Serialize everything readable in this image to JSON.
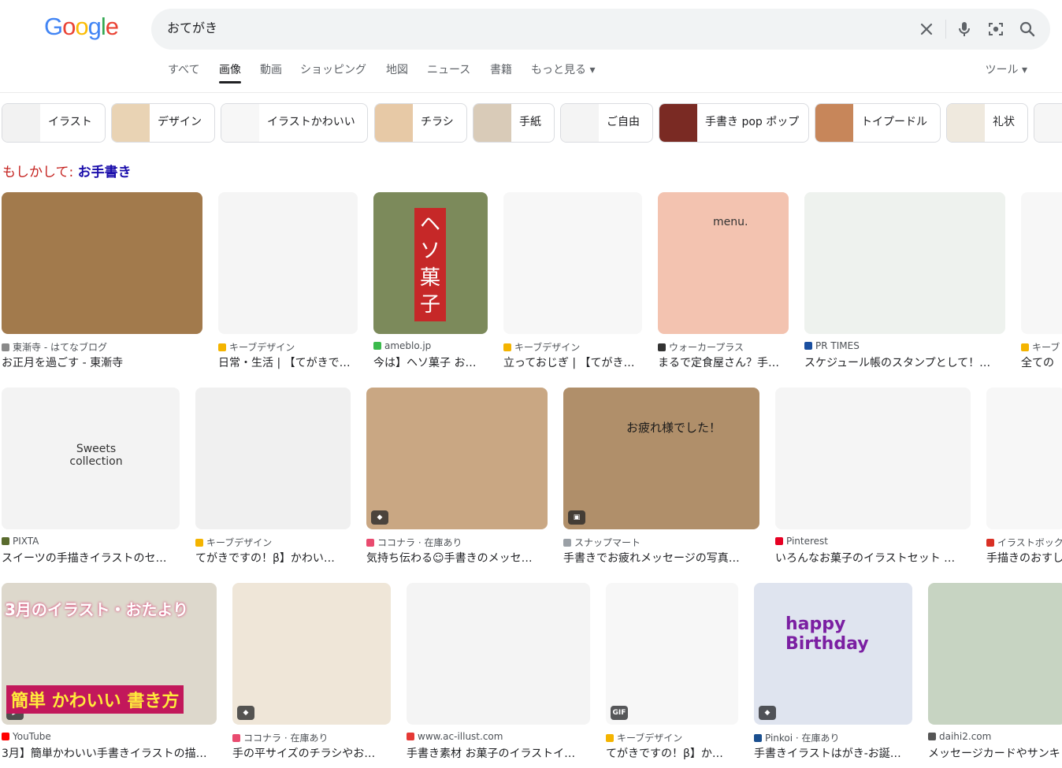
{
  "logo": {
    "letters": [
      {
        "ch": "G",
        "color": "#4285F4"
      },
      {
        "ch": "o",
        "color": "#EA4335"
      },
      {
        "ch": "o",
        "color": "#FBBC05"
      },
      {
        "ch": "g",
        "color": "#4285F4"
      },
      {
        "ch": "l",
        "color": "#34A853"
      },
      {
        "ch": "e",
        "color": "#EA4335"
      }
    ]
  },
  "search": {
    "query": "おてがき"
  },
  "tabs": [
    "すべて",
    "画像",
    "動画",
    "ショッピング",
    "地図",
    "ニュース",
    "書籍",
    "もっと見る ▾"
  ],
  "tools": "ツール ▾",
  "chips": [
    "イラスト",
    "デザイン",
    "イラストかわいい",
    "チラシ",
    "手紙",
    "ご自由",
    "手書き pop ポップ",
    "トイプードル",
    "礼状"
  ],
  "did_you_mean": {
    "prefix": "もしかして: ",
    "suggestion": "お手書き"
  },
  "results": [
    {
      "source": "東漸寺 - はてなブログ",
      "title": "お正月を過ごす - 東漸寺",
      "icon_color": "#8a8a8a",
      "thumb": "#a27a4c"
    },
    {
      "source": "キーブデザイン",
      "title": "日常・生活 | 【てがきで…",
      "icon_color": "#f4b400",
      "thumb": "#f5f5f5"
    },
    {
      "source": "ameblo.jp",
      "title": "今は】ヘソ菓子 お…",
      "icon_color": "#3bba4c",
      "thumb": "#7c8a5b"
    },
    {
      "source": "キーブデザイン",
      "title": "立っておじぎ | 【てがき…",
      "icon_color": "#f4b400",
      "thumb": "#f7f7f7"
    },
    {
      "source": "ウォーカープラス",
      "title": "まるで定食屋さん？手…",
      "icon_color": "#333333",
      "thumb": "#f3c3b0"
    },
    {
      "source": "PR TIMES",
      "title": "スケジュール帳のスタンプとして！…",
      "icon_color": "#1a4fa0",
      "thumb": "#eef2ee"
    },
    {
      "source": "キーブ",
      "title": "全ての",
      "icon_color": "#f4b400",
      "thumb": "#f7f7f7"
    },
    {
      "source": "PIXTA",
      "title": "スイーツの手描きイラストのセ…",
      "icon_color": "#5a6b2e",
      "thumb": "#f3f3f3"
    },
    {
      "source": "キーブデザイン",
      "title": "てがきですの！β】かわい…",
      "icon_color": "#f4b400",
      "thumb": "#f0f0f0"
    },
    {
      "source": "ココナラ · 在庫あり",
      "title": "気持ち伝わる☺手書きのメッセ…",
      "icon_color": "#e94b6f",
      "thumb": "#c9a783"
    },
    {
      "source": "スナップマート",
      "title": "手書きでお疲れメッセージの写真…",
      "icon_color": "#9aa0a6",
      "thumb": "#b08f6a"
    },
    {
      "source": "Pinterest",
      "title": "いろんなお菓子のイラストセット …",
      "icon_color": "#e60023",
      "thumb": "#f5f5f5"
    },
    {
      "source": "イラストボック",
      "title": "手描きのおすし",
      "icon_color": "#d93025",
      "thumb": "#f7f7f7"
    },
    {
      "source": "YouTube",
      "title": "3月】簡単かわいい手書きイラストの描…",
      "icon_color": "#ff0000",
      "thumb": "#ddd8cc"
    },
    {
      "source": "ココナラ · 在庫あり",
      "title": "手の平サイズのチラシやお…",
      "icon_color": "#e94b6f",
      "thumb": "#efe6d8"
    },
    {
      "source": "www.ac-illust.com",
      "title": "手書き素材 お菓子のイラストイ…",
      "icon_color": "#e53935",
      "thumb": "#f4f4f4"
    },
    {
      "source": "キーブデザイン",
      "title": "てがきですの！β】か…",
      "icon_color": "#f4b400",
      "thumb": "#f7f7f7"
    },
    {
      "source": "Pinkoi · 在庫あり",
      "title": "手書きイラストはがき-お誕…",
      "icon_color": "#1a4f8f",
      "thumb": "#dfe4ef"
    },
    {
      "source": "daihi2.com",
      "title": "メッセージカードやサンキ",
      "icon_color": "#555555",
      "thumb": "#c7d4c2"
    }
  ],
  "thumb_texts": {
    "heso": "ヘソ菓子",
    "otsukare": "お疲れ様でした！",
    "sweets": "Sweets collection",
    "march": "3月のイラスト・おたより",
    "kantan": "簡単 かわいい 書き方",
    "happy": "happy Birthday",
    "menu": "menu."
  },
  "badges": {
    "gif": "GIF"
  }
}
